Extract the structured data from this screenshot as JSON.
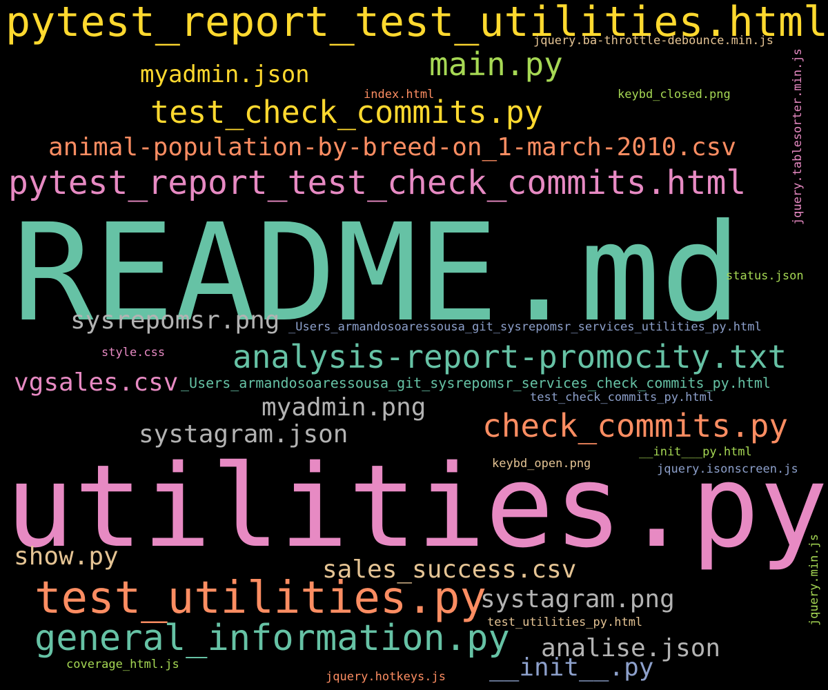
{
  "palette": {
    "background": "#000000",
    "teal": "#66c2a5",
    "orange": "#fc8d62",
    "pink": "#e78ac3",
    "lime": "#a6d854",
    "yellow": "#ffd92f",
    "tan": "#e5c494",
    "gray": "#b3b3b3",
    "blue": "#8da0cb"
  },
  "words": [
    {
      "text": "pytest_report_test_utilities.html"
    },
    {
      "text": "jquery.ba-throttle-debounce.min.js"
    },
    {
      "text": "main.py"
    },
    {
      "text": "myadmin.json"
    },
    {
      "text": "jquery.tablesorter.min.js"
    },
    {
      "text": "index.html"
    },
    {
      "text": "keybd_closed.png"
    },
    {
      "text": "test_check_commits.py"
    },
    {
      "text": "animal-population-by-breed-on_1-march-2010.csv"
    },
    {
      "text": "pytest_report_test_check_commits.html"
    },
    {
      "text": "README.md"
    },
    {
      "text": "status.json"
    },
    {
      "text": "sysrepomsr.png"
    },
    {
      "text": "_Users_armandosoaressousa_git_sysrepomsr_services_utilities_py.html"
    },
    {
      "text": "style.css"
    },
    {
      "text": "analysis-report-promocity.txt"
    },
    {
      "text": "vgsales.csv"
    },
    {
      "text": "_Users_armandosoaressousa_git_sysrepomsr_services_check_commits_py.html"
    },
    {
      "text": "test_check_commits_py.html"
    },
    {
      "text": "myadmin.png"
    },
    {
      "text": "check_commits.py"
    },
    {
      "text": "systagram.json"
    },
    {
      "text": "__init___py.html"
    },
    {
      "text": "keybd_open.png"
    },
    {
      "text": "jquery.isonscreen.js"
    },
    {
      "text": "utilities.py"
    },
    {
      "text": "jquery.min.js"
    },
    {
      "text": "show.py"
    },
    {
      "text": "sales_success.csv"
    },
    {
      "text": "test_utilities.py"
    },
    {
      "text": "systagram.png"
    },
    {
      "text": "test_utilities_py.html"
    },
    {
      "text": "general_information.py"
    },
    {
      "text": "analise.json"
    },
    {
      "text": "coverage_html.js"
    },
    {
      "text": "__init__.py"
    },
    {
      "text": "jquery.hotkeys.js"
    }
  ]
}
